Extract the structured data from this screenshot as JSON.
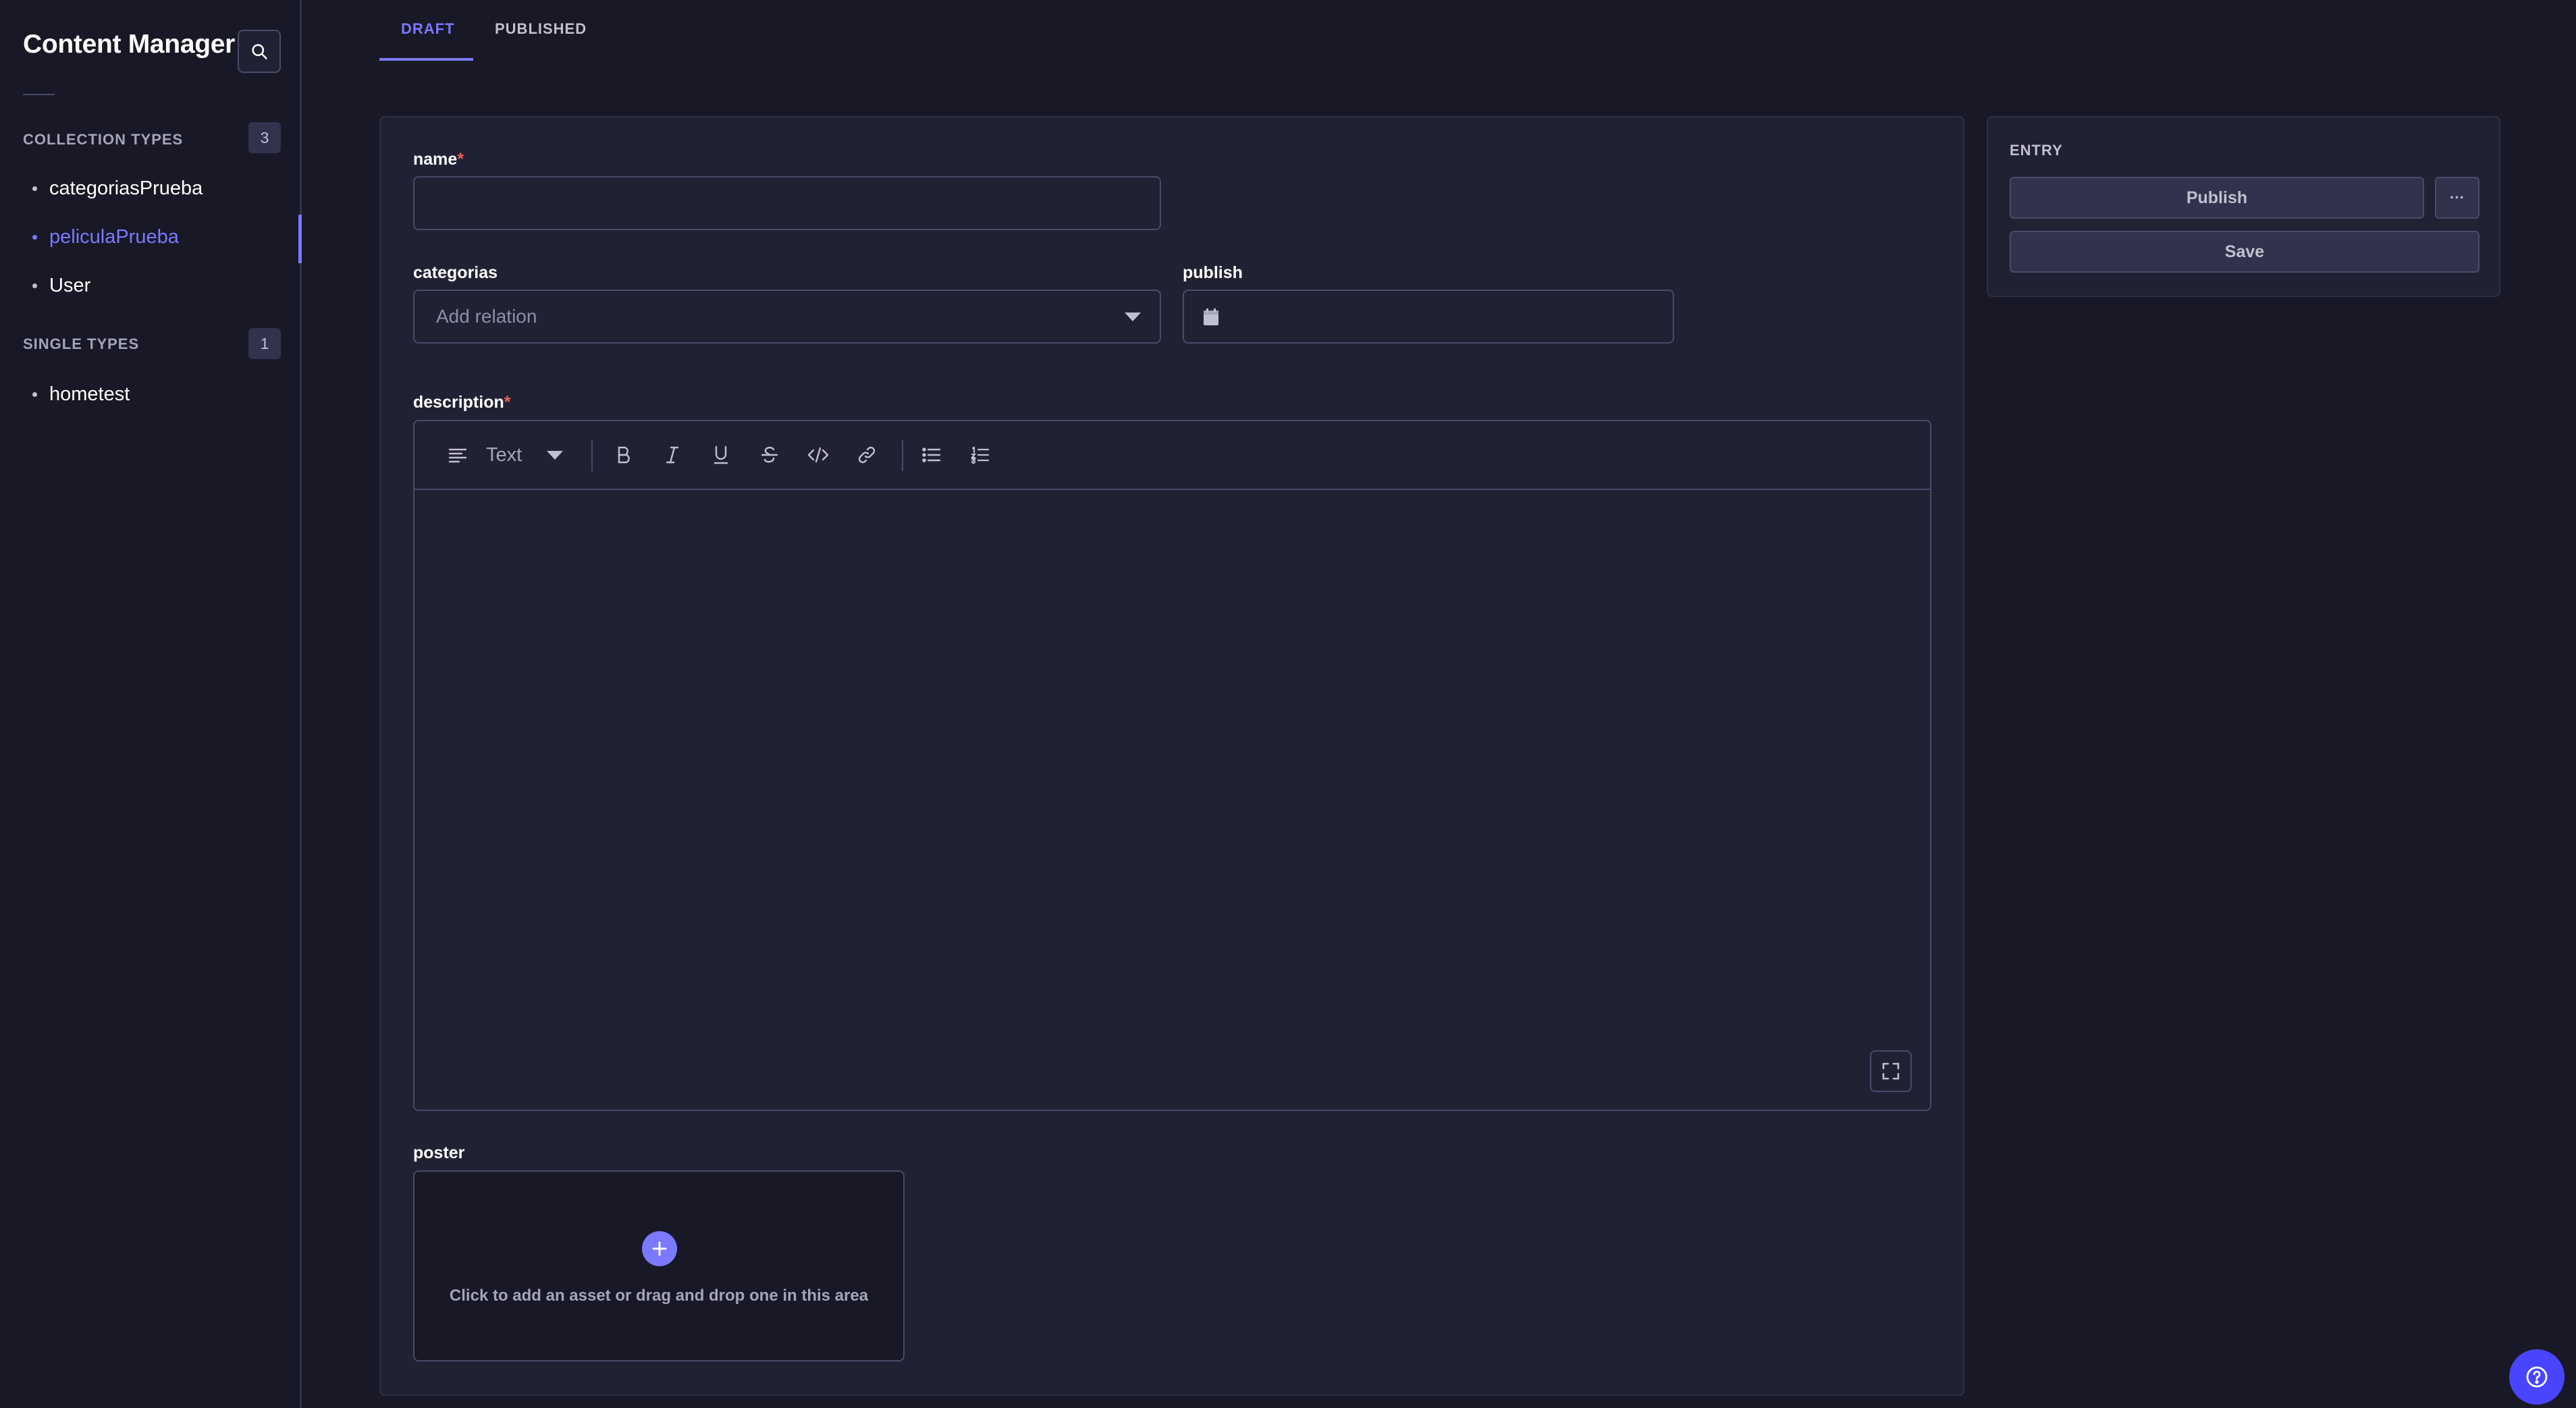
{
  "sidebar": {
    "title": "Content Manager",
    "collection_types": {
      "label": "COLLECTION TYPES",
      "count": "3",
      "items": [
        {
          "label": "categoriasPrueba"
        },
        {
          "label": "peliculaPrueba"
        },
        {
          "label": "User"
        }
      ]
    },
    "single_types": {
      "label": "SINGLE TYPES",
      "count": "1",
      "items": [
        {
          "label": "hometest"
        }
      ]
    }
  },
  "tabs": {
    "draft": "DRAFT",
    "published": "PUBLISHED",
    "active": "DRAFT"
  },
  "form": {
    "name": {
      "label": "name",
      "required_mark": "*",
      "value": ""
    },
    "categorias": {
      "label": "categorias",
      "placeholder": "Add relation"
    },
    "publish": {
      "label": "publish",
      "value": ""
    },
    "description": {
      "label": "description",
      "required_mark": "*",
      "toolbar": {
        "block_type": "Text"
      }
    },
    "poster": {
      "label": "poster",
      "dropzone_text": "Click to add an asset or drag and drop one in this area"
    }
  },
  "entry_panel": {
    "title": "ENTRY",
    "publish_label": "Publish",
    "more_label": "···",
    "save_label": "Save"
  },
  "colors": {
    "accent": "#7b79ff",
    "required": "#ee5e52",
    "background": "#181826",
    "surface": "#212134",
    "help_button": "#4945ff"
  }
}
